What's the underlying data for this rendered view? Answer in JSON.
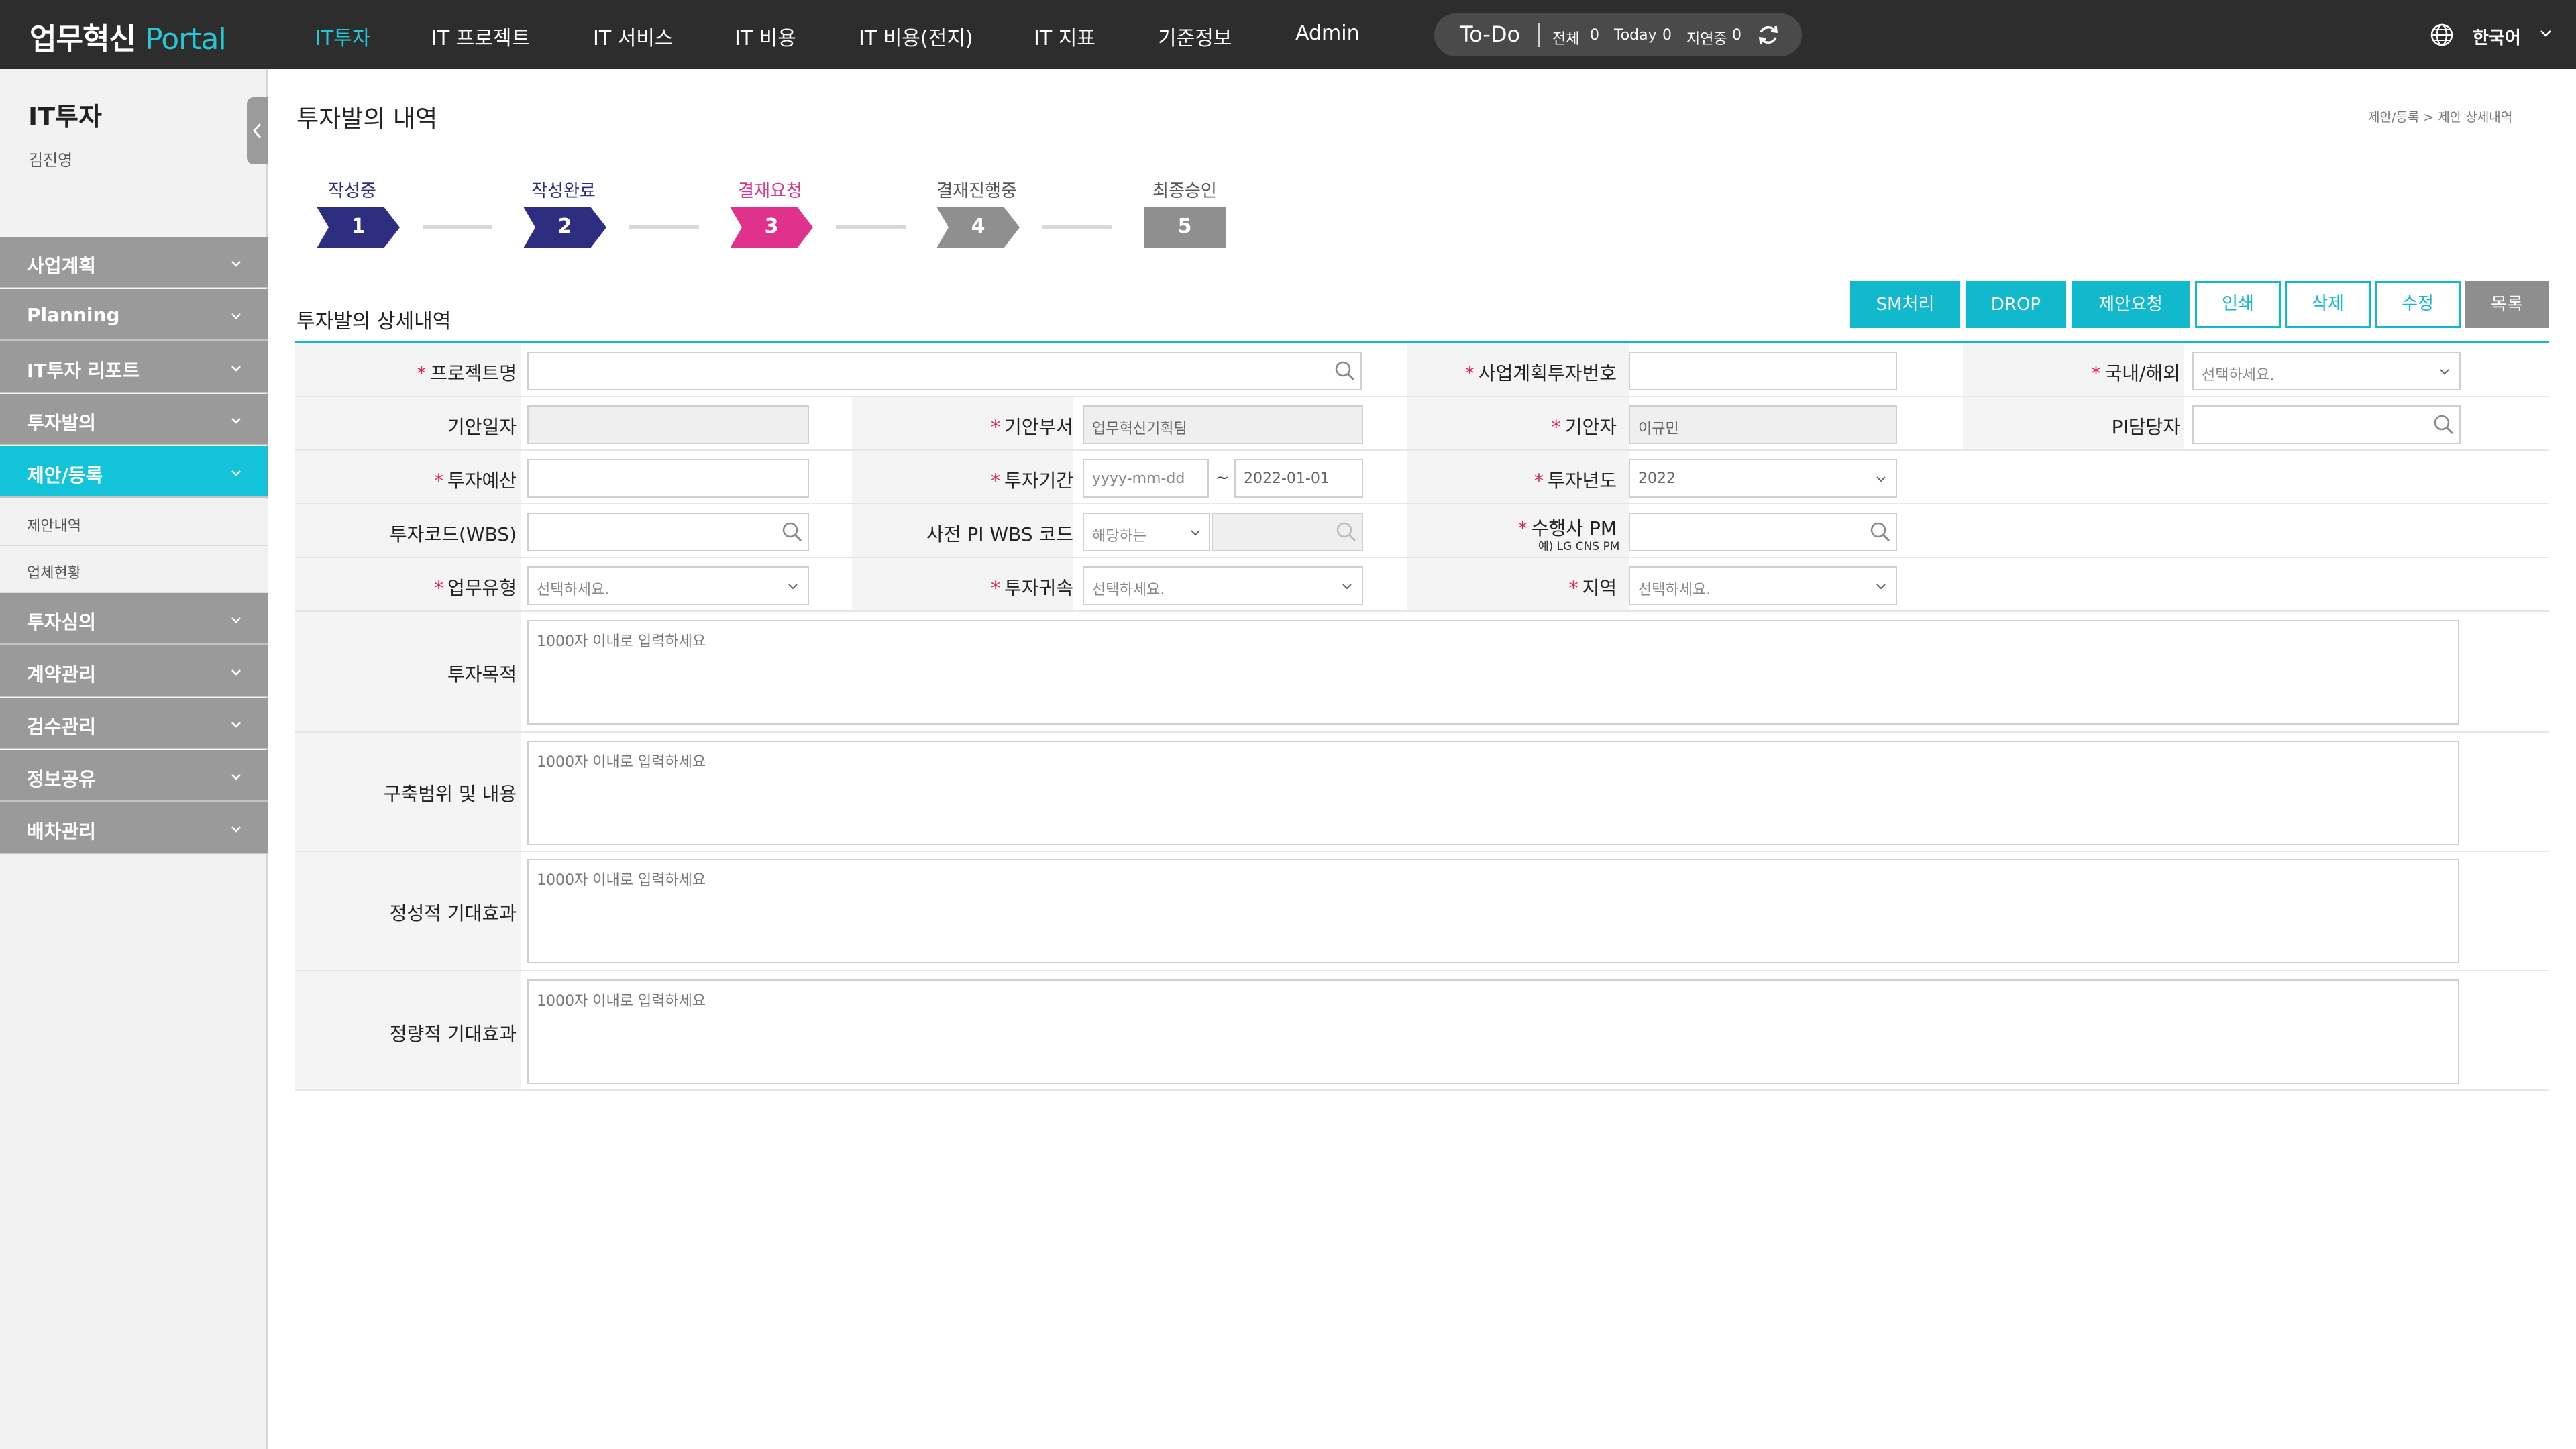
{
  "app": {
    "logo_main": "업무혁신",
    "logo_accent": "Portal"
  },
  "nav": {
    "items": [
      "IT투자",
      "IT 프로젝트",
      "IT 서비스",
      "IT 비용",
      "IT 비용(전지)",
      "IT 지표",
      "기준정보",
      "Admin"
    ],
    "active": "IT투자"
  },
  "todo": {
    "title": "To-Do",
    "all_label": "전체",
    "all_count": "0",
    "today_label": "Today",
    "today_count": "0",
    "delay_label": "지연중",
    "delay_count": "0"
  },
  "language": {
    "label": "한국어",
    "icon": "globe-icon"
  },
  "sidebar": {
    "title": "IT투자",
    "user": "김진영",
    "menu": [
      "사업계획",
      "Planning",
      "IT투자 리포트",
      "투자발의",
      "제안/등록",
      "투자심의",
      "계약관리",
      "검수관리",
      "정보공유",
      "배차관리"
    ],
    "active_menu": "제안/등록",
    "submenu": [
      "제안내역",
      "업체현황"
    ]
  },
  "page": {
    "title": "투자발의 내역",
    "breadcrumb": "제안/등록 > 제안 상세내역"
  },
  "steps": [
    {
      "label": "작성중",
      "num": "1",
      "state": "done"
    },
    {
      "label": "작성완료",
      "num": "2",
      "state": "done"
    },
    {
      "label": "결재요청",
      "num": "3",
      "state": "current"
    },
    {
      "label": "결재진행중",
      "num": "4",
      "state": "pending"
    },
    {
      "label": "최종승인",
      "num": "5",
      "state": "final"
    }
  ],
  "colors": {
    "accent": "#12b9cc",
    "done": "#2e2e80",
    "current": "#e0328c",
    "pending": "#8f8f8f",
    "required": "#e0224c"
  },
  "section": {
    "title": "투자발의 상세내역"
  },
  "buttons": {
    "sm": "SM처리",
    "drop": "DROP",
    "request": "제안요청",
    "print": "인쇄",
    "delete": "삭제",
    "edit": "수정",
    "list": "목록"
  },
  "form": {
    "project_name": {
      "label": "프로젝트명",
      "value": ""
    },
    "plan_invest_no": {
      "label": "사업계획투자번호",
      "value": ""
    },
    "domestic": {
      "label": "국내/해외",
      "value": "선택하세요."
    },
    "draft_date": {
      "label": "기안일자",
      "value": ""
    },
    "draft_dept": {
      "label": "기안부서",
      "value": "업무혁신기획팀"
    },
    "drafter": {
      "label": "기안자",
      "value": "이규민"
    },
    "pi_manager": {
      "label": "PI담당자",
      "value": ""
    },
    "budget": {
      "label": "투자예산",
      "value": ""
    },
    "period": {
      "label": "투자기간",
      "start_placeholder": "yyyy-mm-dd",
      "sep": "~",
      "end_value": "2022-01-01"
    },
    "invest_year": {
      "label": "투자년도",
      "value": "2022"
    },
    "invest_code": {
      "label": "투자코드(WBS)",
      "value": ""
    },
    "pre_wbs": {
      "label": "사전 PI WBS 코드",
      "select_value": "해당하는",
      "value": ""
    },
    "vendor_pm": {
      "label": "수행사 PM",
      "note": "예) LG CNS PM",
      "value": ""
    },
    "work_type": {
      "label": "업무유형",
      "value": "선택하세요."
    },
    "invest_owner": {
      "label": "투자귀속",
      "value": "선택하세요."
    },
    "region": {
      "label": "지역",
      "value": "선택하세요."
    },
    "purpose": {
      "label": "투자목적",
      "placeholder": "1000자 이내로 입력하세요"
    },
    "scope": {
      "label": "구축범위 및 내용",
      "placeholder": "1000자 이내로 입력하세요"
    },
    "qualitative": {
      "label": "정성적 기대효과",
      "placeholder": "1000자 이내로 입력하세요"
    },
    "quantitative": {
      "label": "정량적 기대효과",
      "placeholder": "1000자 이내로 입력하세요"
    }
  }
}
